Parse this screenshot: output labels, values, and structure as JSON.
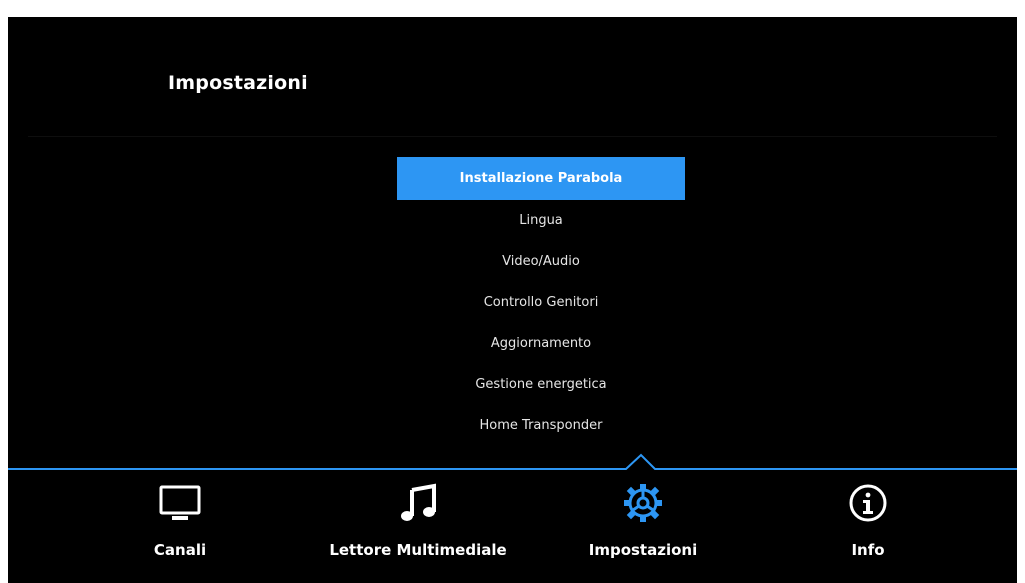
{
  "header": {
    "title": "Impostazioni"
  },
  "menu": {
    "selected_index": 0,
    "items": [
      {
        "label": "Installazione Parabola"
      },
      {
        "label": "Lingua"
      },
      {
        "label": "Video/Audio"
      },
      {
        "label": "Controllo Genitori"
      },
      {
        "label": "Aggiornamento"
      },
      {
        "label": "Gestione energetica"
      },
      {
        "label": "Home Transponder"
      }
    ]
  },
  "bottom_nav": {
    "active_index": 2,
    "tabs": [
      {
        "label": "Canali",
        "icon": "tv-icon"
      },
      {
        "label": "Lettore Multimediale",
        "icon": "music-note-icon"
      },
      {
        "label": "Impostazioni",
        "icon": "gear-icon"
      },
      {
        "label": "Info",
        "icon": "info-icon"
      }
    ]
  },
  "colors": {
    "background": "#000000",
    "accent": "#2d96f3",
    "text": "#ffffff"
  }
}
